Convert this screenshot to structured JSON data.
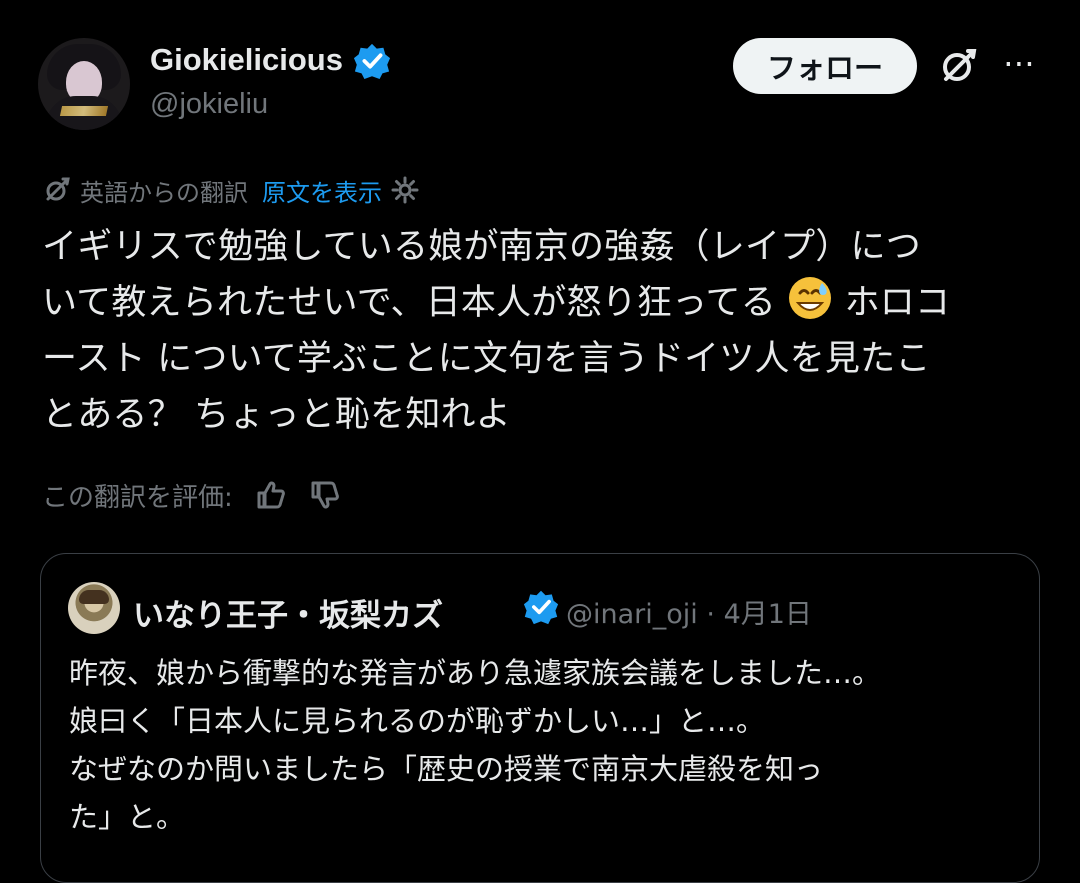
{
  "post": {
    "author": {
      "display_name": "Giokielicious",
      "handle": "@jokieliu",
      "verified": true
    },
    "follow_label": "フォロー",
    "translation": {
      "label": "英語からの翻訳",
      "show_original": "原文を表示"
    },
    "text": {
      "line1": "イギリスで勉強している娘が南京の強姦（レイプ）につ",
      "line2a": "いて教えられたせいで、日本人が怒り狂ってる",
      "line2b": " ホロコ",
      "line3": "ースト について学ぶことに文句を言うドイツ人を見たこ",
      "line4": "とある？ ちょっと恥を知れよ"
    },
    "rate_translation": "この翻訳を評価:"
  },
  "quote": {
    "author": {
      "display_name": "いなり王子・坂梨カズ",
      "handle": "@inari_oji",
      "date": "4月1日",
      "verified": true
    },
    "lines": [
      "昨夜、娘から衝撃的な発言があり急遽家族会議をしました…。",
      "娘曰く「日本人に見られるのが恥ずかしい…」と…。",
      "なぜなのか問いましたら「歴史の授業で南京大虐殺を知っ",
      "た」と。"
    ]
  },
  "icons": {
    "verified": "verified-badge-icon",
    "grok": "grok-icon",
    "more": "more-icon",
    "translation": "grok-translation-icon",
    "settings": "gear-icon",
    "thumbs_up": "thumbs-up-icon",
    "thumbs_down": "thumbs-down-icon",
    "emoji": "grinning-sweat-emoji"
  },
  "colors": {
    "background": "#000000",
    "text": "#e7e9ea",
    "muted": "#71767b",
    "link": "#1d9bf0",
    "verified": "#1d9bf0"
  }
}
